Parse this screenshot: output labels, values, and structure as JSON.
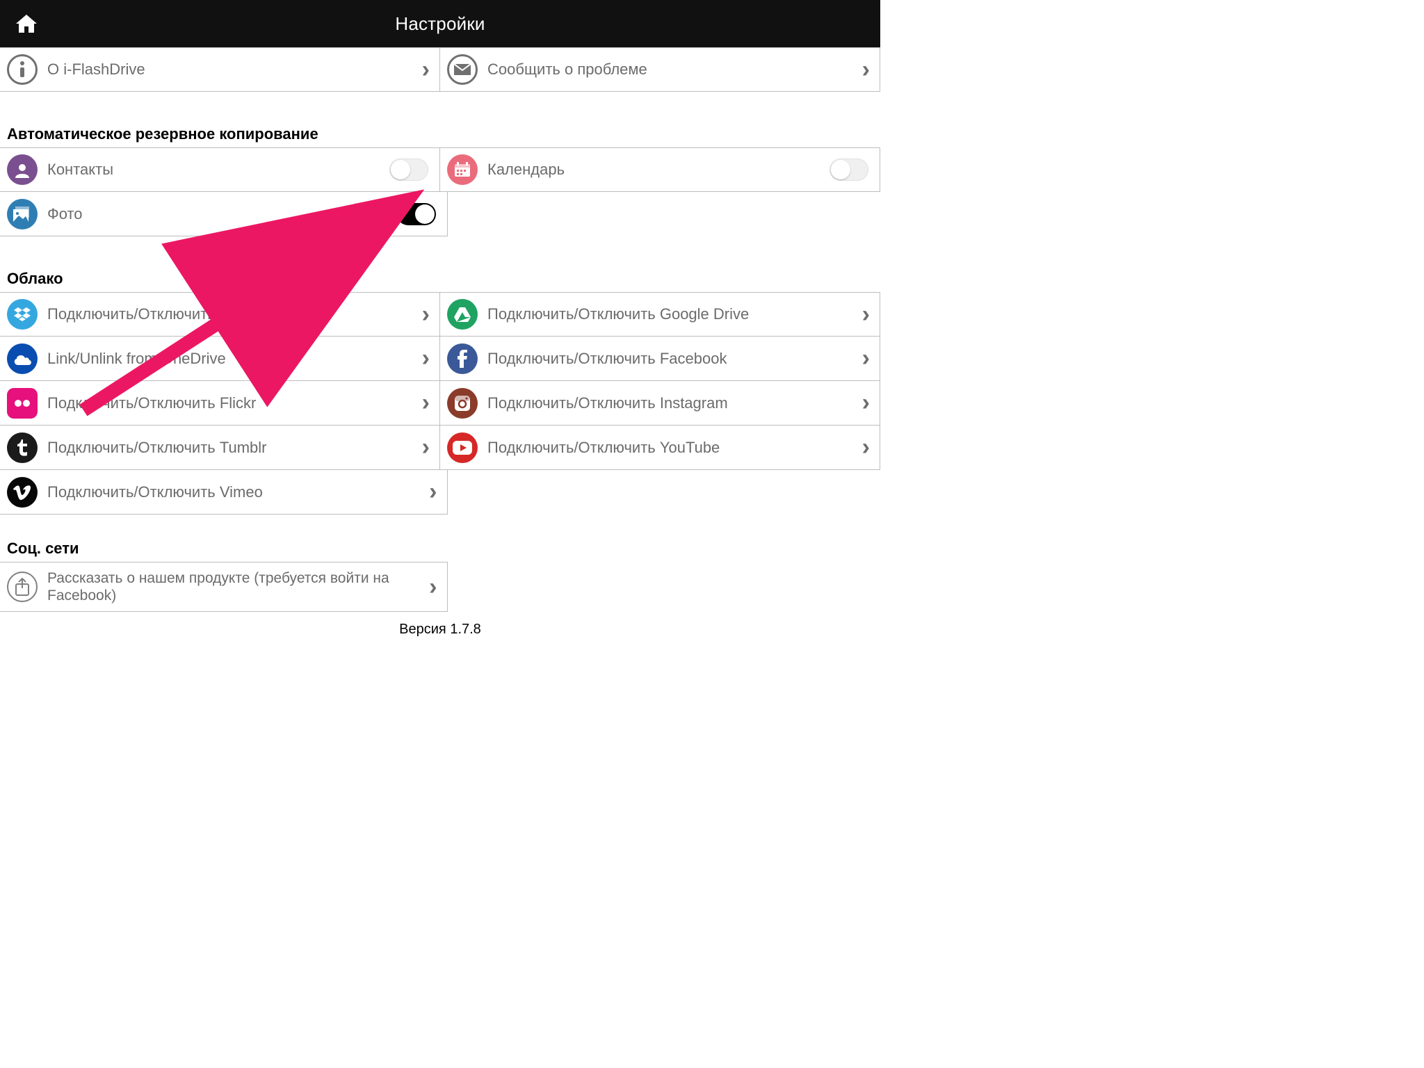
{
  "header": {
    "title": "Настройки"
  },
  "info": {
    "about": "О i-FlashDrive",
    "report": "Сообщить о проблеме"
  },
  "backup": {
    "title": "Автоматическое резервное копирование",
    "contacts": "Контакты",
    "calendar": "Календарь",
    "photo": "Фото"
  },
  "cloud": {
    "title": "Облако",
    "dropbox": "Подключить/Отключить Dropbox",
    "gdrive": "Подключить/Отключить Google Drive",
    "onedrive": "Link/Unlink from OneDrive",
    "facebook": "Подключить/Отключить Facebook",
    "flickr": "Подключить/Отключить  Flickr",
    "instagram": "Подключить/Отключить Instagram",
    "tumblr": "Подключить/Отключить Tumblr",
    "youtube": "Подключить/Отключить YouTube",
    "vimeo": "Подключить/Отключить Vimeo"
  },
  "social": {
    "title": "Соц. сети",
    "share": "Рассказать о нашем продукте (требуется войти на Facebook)"
  },
  "footer": {
    "version": "Версия 1.7.8"
  }
}
